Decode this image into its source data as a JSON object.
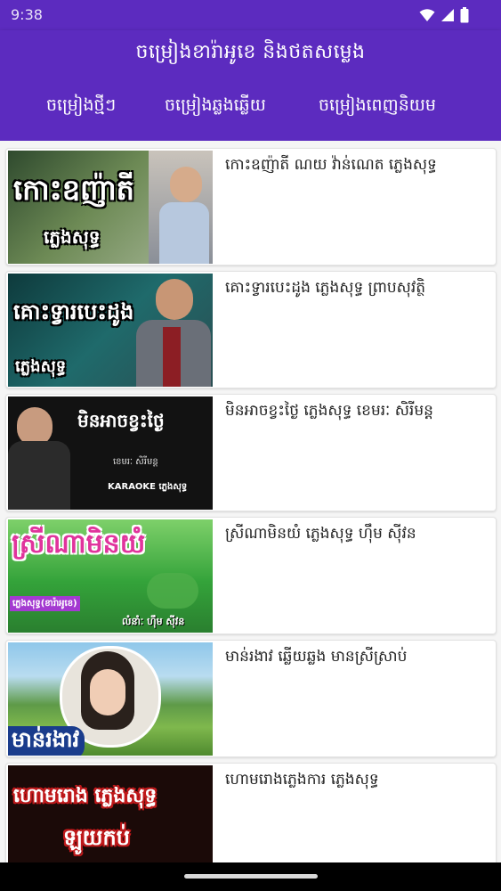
{
  "status_bar": {
    "time": "9:38",
    "icons": [
      "wifi-icon",
      "signal-icon",
      "battery-icon"
    ]
  },
  "header": {
    "title": "ចម្រៀងខារ៉ាអូខេ និងថតសម្លេង",
    "background": "#5c2bbf",
    "tabs": [
      {
        "label": "ចម្រៀងថ្មីៗ"
      },
      {
        "label": "ចម្រៀងឆ្លងឆ្លើយ"
      },
      {
        "label": "ចម្រៀងពេញនិយម"
      }
    ]
  },
  "songs": [
    {
      "title": "កោះឧញ៉ាតី ណយ វ៉ាន់ណេត ភ្លេងសុទ្ធ",
      "thumb_text": "កោះឧញ៉ាតី",
      "thumb_subtext": "ភ្លេងសុទ្ធ"
    },
    {
      "title": "គោះទ្វារបេះដូង ភ្លេងសុទ្ធ ព្រាបសុវត្ថិ",
      "thumb_text": "គោះទ្វារបេះដូង",
      "thumb_subtext": "ភ្លេងសុទ្ធ"
    },
    {
      "title": "មិនអាចខ្វះថ្ងៃ ភ្លេងសុទ្ធ ខេមរៈ សិរីមន្ត",
      "thumb_text": "មិនអាចខ្វះថ្ងៃ",
      "thumb_subtext": "ខេមរៈ សិរីមន្ត",
      "thumb_caption": "KARAOKE ភ្លេងសុទ្ធ"
    },
    {
      "title": "ស្រីណាមិនយំ ភ្លេងសុទ្ធ ហ៊ឹម ស៊ីវន",
      "thumb_text": "ស្រីណាមិនយំ",
      "thumb_subtext": "ភ្លេងសុទ្ធ(ខារ៉ាអូខេ)",
      "thumb_caption": "លំនាំៈ ហ៊ឹម ស៊ីវន"
    },
    {
      "title": "មាន់រងាវ ឆ្លើយឆ្លង មានស្រីស្រាប់",
      "thumb_text": "មាន់រងាវ"
    },
    {
      "title": "ហោមរោងភ្លេងការ ភ្លេងសុទ្ធ",
      "thumb_text": "ហោមរោង ភ្លេងសុទ្ធ",
      "thumb_subtext": "ឡូយកប់"
    }
  ]
}
